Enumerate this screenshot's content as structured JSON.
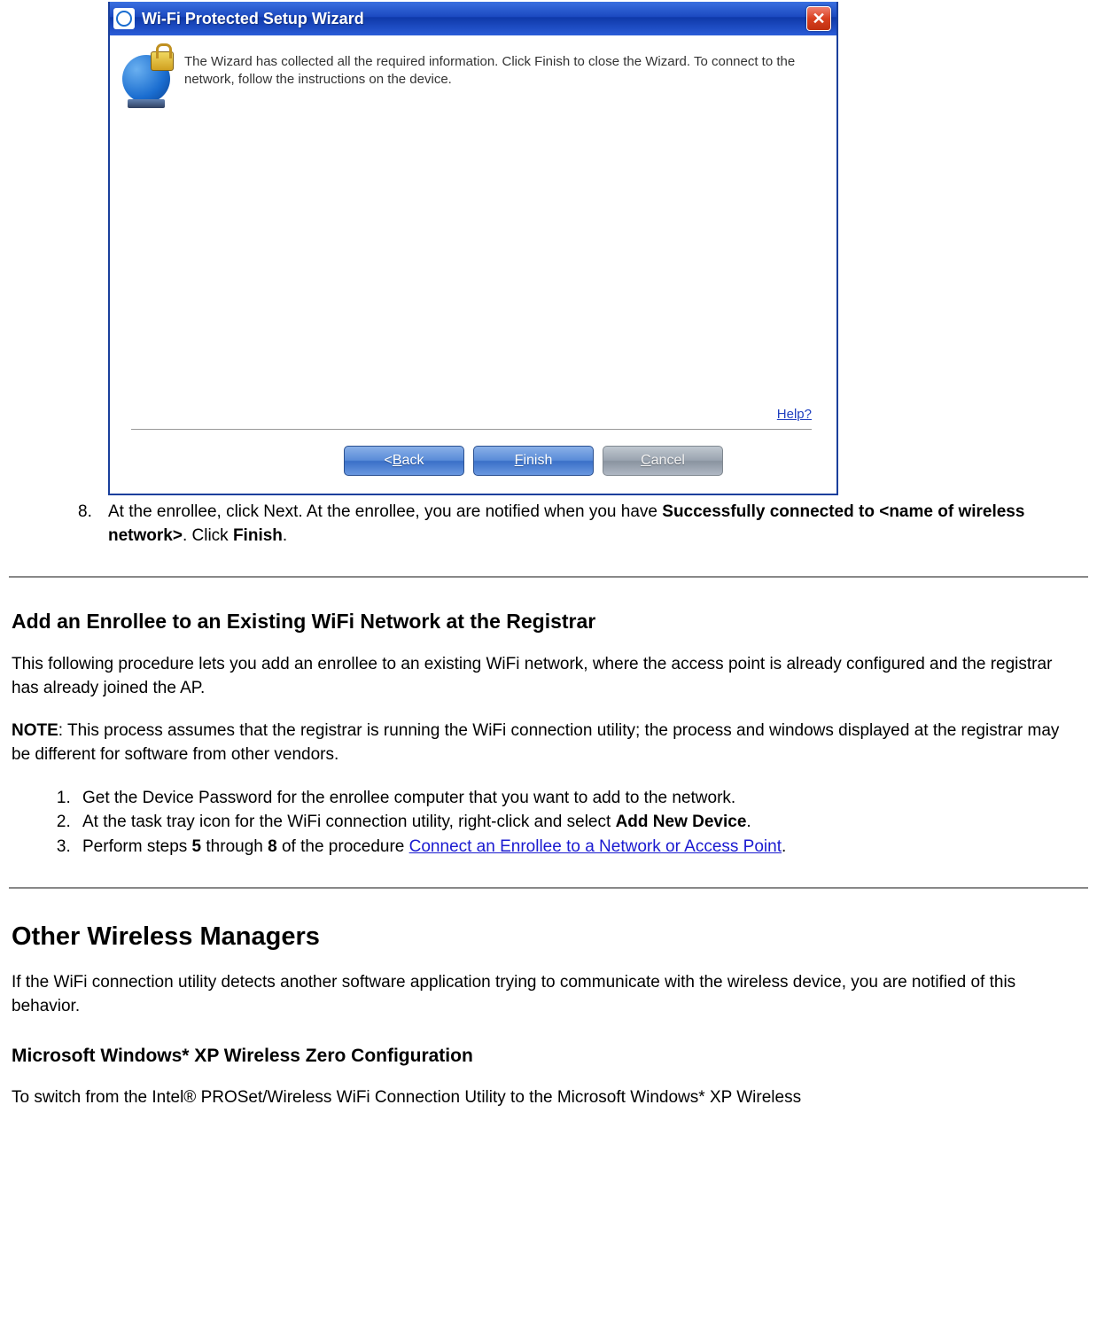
{
  "wizard": {
    "title": "Wi-Fi Protected Setup Wizard",
    "info_text": "The Wizard has collected all the required information. Click Finish to close the Wizard. To connect to the network, follow the instructions on the device.",
    "help_label": "Help?",
    "buttons": {
      "back_prefix": "< ",
      "back_letter": "B",
      "back_rest": "ack",
      "finish_letter": "F",
      "finish_rest": "inish",
      "cancel_letter": "C",
      "cancel_rest": "ancel"
    }
  },
  "step8": {
    "text_a": "At the enrollee, click Next. At the enrollee, you are notified when you have ",
    "bold_a": "Successfully connected to <name of wireless network>",
    "text_b": ". Click ",
    "bold_b": "Finish",
    "text_c": "."
  },
  "section1": {
    "heading": "Add an Enrollee to an Existing WiFi Network at the Registrar",
    "para1": "This following procedure lets you add an enrollee to an existing WiFi network, where the access point is already configured and the registrar has already joined the AP.",
    "note_label": "NOTE",
    "note_text": ": This process assumes that the registrar is running the WiFi connection utility; the process and windows displayed at the registrar may be different for software from other vendors.",
    "li1": "Get the Device Password for the enrollee computer that you want to add to the network.",
    "li2_a": "At the task tray icon for the WiFi connection utility, right-click and select ",
    "li2_bold": "Add New Device",
    "li2_b": ".",
    "li3_a": "Perform steps ",
    "li3_bold1": "5",
    "li3_mid": " through ",
    "li3_bold2": "8",
    "li3_b": " of the procedure ",
    "li3_link": "Connect an Enrollee to a Network or Access Point",
    "li3_c": "."
  },
  "section2": {
    "heading": "Other Wireless Managers",
    "para1": "If the WiFi connection utility detects another software application trying to communicate with the wireless device, you are notified of this behavior.",
    "subheading": "Microsoft Windows* XP Wireless Zero Configuration",
    "para2": "To switch from the Intel® PROSet/Wireless WiFi Connection Utility to the Microsoft Windows* XP Wireless"
  }
}
